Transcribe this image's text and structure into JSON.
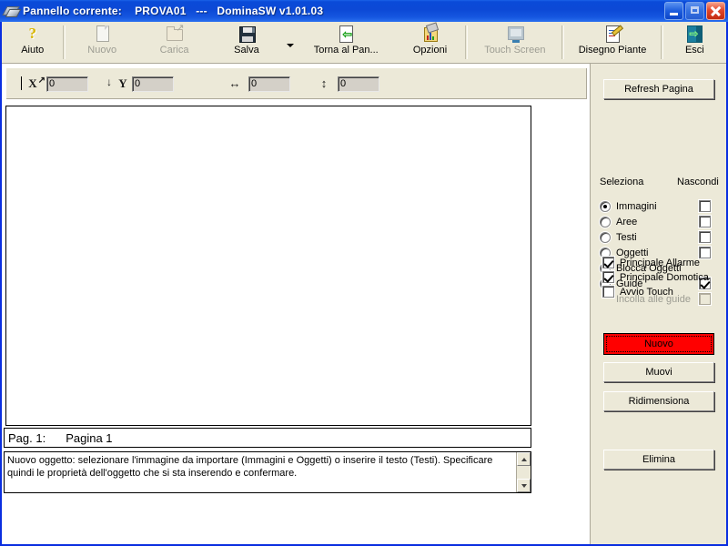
{
  "window": {
    "title": "Pannello corrente:    PROVA01   ---   DominaSW v1.01.03",
    "icon": "panel-icon",
    "controls": {
      "minimize": "minimize-button",
      "maximize": "maximize-button",
      "close": "close-button"
    }
  },
  "toolbar": {
    "items": [
      {
        "label": "Aiuto",
        "icon": "help-question-icon",
        "enabled": true
      },
      {
        "label": "Nuovo",
        "icon": "new-page-icon",
        "enabled": false
      },
      {
        "label": "Carica",
        "icon": "open-folder-icon",
        "enabled": false
      },
      {
        "label": "Salva",
        "icon": "floppy-save-icon",
        "enabled": true
      },
      {
        "label": "Torna al Pan...",
        "icon": "back-arrow-icon",
        "enabled": true
      },
      {
        "label": "Opzioni",
        "icon": "options-chart-icon",
        "enabled": true
      },
      {
        "label": "Touch Screen",
        "icon": "monitor-icon",
        "enabled": false
      },
      {
        "label": "Disegno Piante",
        "icon": "clipboard-pencil-icon",
        "enabled": true
      },
      {
        "label": "Esci",
        "icon": "exit-door-icon",
        "enabled": true
      }
    ]
  },
  "coord_bar": {
    "x_label": "X",
    "x_value": "0",
    "y_label": "Y",
    "y_value": "0",
    "width_value": "0",
    "height_value": "0",
    "width_icon": "horizontal-arrow-icon",
    "height_icon": "vertical-arrow-icon"
  },
  "page": {
    "number_label": "Pag. 1:",
    "name": "Pagina 1"
  },
  "status": {
    "message": "Nuovo oggetto: selezionare l'immagine da importare (Immagini e Oggetti) o inserire il testo (Testi). Specificare quindi le proprietà dell'oggetto che si sta inserendo e confermare."
  },
  "right_panel": {
    "refresh_label": "Refresh Pagina",
    "column_headers": {
      "select": "Seleziona",
      "hide": "Nascondi"
    },
    "layer_rows": [
      {
        "label": "Immagini",
        "selected": true,
        "enabled": true,
        "has_checkbox": true,
        "checked": false
      },
      {
        "label": "Aree",
        "selected": false,
        "enabled": true,
        "has_checkbox": true,
        "checked": false
      },
      {
        "label": "Testi",
        "selected": false,
        "enabled": true,
        "has_checkbox": true,
        "checked": false
      },
      {
        "label": "Oggetti",
        "selected": false,
        "enabled": true,
        "has_checkbox": true,
        "checked": false
      },
      {
        "label": "Blocca Oggetti",
        "selected": false,
        "enabled": true,
        "has_checkbox": false,
        "checked": false
      },
      {
        "label": "Guide",
        "selected": false,
        "enabled": true,
        "has_checkbox": true,
        "checked": true
      },
      {
        "label": "Incolla alle guide",
        "selected": false,
        "enabled": false,
        "has_checkbox": true,
        "checked": false
      }
    ],
    "option_checkboxes": [
      {
        "label": "Principale Allarme",
        "checked": true
      },
      {
        "label": "Principale Domotica",
        "checked": true
      },
      {
        "label": "Avvio Touch",
        "checked": false
      }
    ],
    "actions": {
      "nuovo": "Nuovo",
      "muovi": "Muovi",
      "ridimensiona": "Ridimensiona",
      "elimina": "Elimina"
    }
  },
  "colors": {
    "title_bar_blue": "#0c49d6",
    "window_border_blue": "#0a2ee0",
    "panel_beige": "#ece9d8",
    "nuovo_button_red": "#ff0000",
    "close_button_red": "#e2472b"
  }
}
